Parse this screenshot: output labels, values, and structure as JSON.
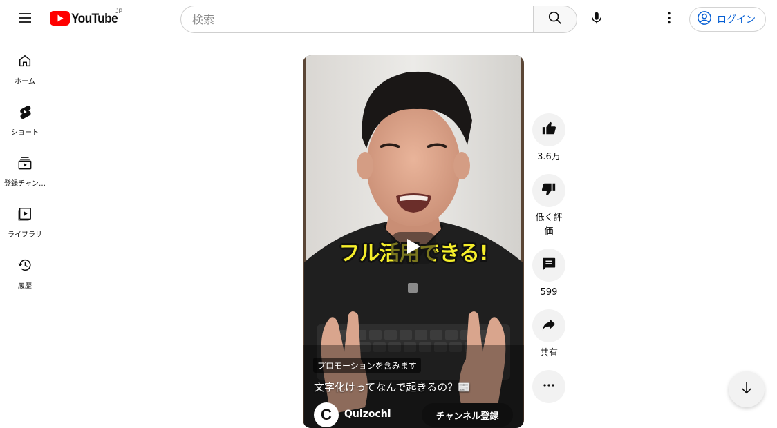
{
  "header": {
    "logo_text": "YouTube",
    "region": "JP",
    "search_placeholder": "検索",
    "signin_label": "ログイン",
    "brand_color": "#ff0000",
    "link_color": "#065fd4"
  },
  "sidebar": {
    "items": [
      {
        "label": "ホーム",
        "icon": "home-icon"
      },
      {
        "label": "ショート",
        "icon": "shorts-icon"
      },
      {
        "label": "登録チャン…",
        "icon": "subscriptions-icon"
      },
      {
        "label": "ライブラリ",
        "icon": "library-icon"
      },
      {
        "label": "履歴",
        "icon": "history-icon"
      }
    ]
  },
  "short": {
    "caption_overlay": "フル活用できる!",
    "promo_badge": "プロモーションを含みます",
    "title": "文字化けってなんで起きるの？📰",
    "channel_name": "Quizochi",
    "subscribe_label": "チャンネル登録"
  },
  "actions": {
    "like_count": "3.6万",
    "dislike_label": "低く評価",
    "comment_count": "599",
    "share_label": "共有"
  }
}
